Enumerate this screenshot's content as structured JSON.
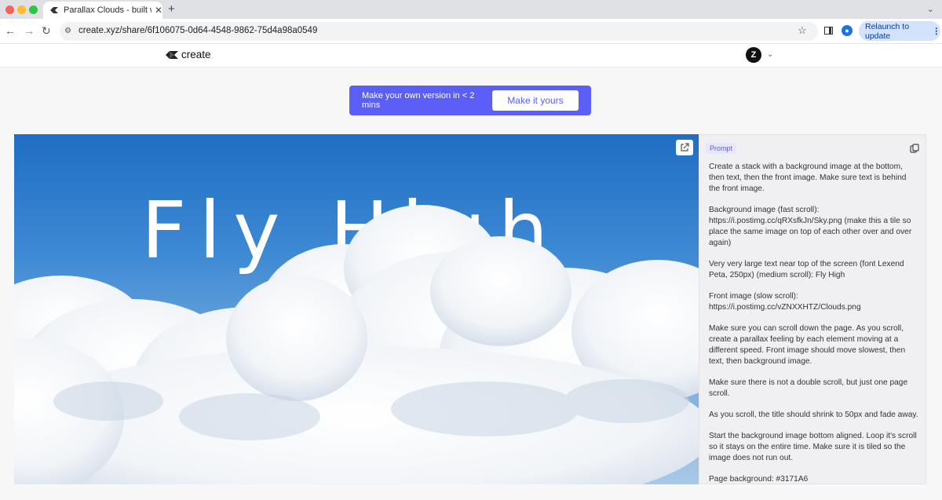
{
  "browser": {
    "tab_title": "Parallax Clouds - built with C",
    "url": "create.xyz/share/6f106075-0d64-4548-9862-75d4a98a0549",
    "relaunch_label": "Relaunch to update"
  },
  "site": {
    "logo_text": "create",
    "avatar_letter": "Z"
  },
  "cta": {
    "text": "Make your own version in < 2 mins",
    "button_label": "Make it yours"
  },
  "preview": {
    "headline": "Fly High"
  },
  "prompt": {
    "badge": "Prompt",
    "paragraphs": [
      "Create a stack with a background image at the bottom, then text, then the front image. Make sure text is behind the front image.",
      "Background image (fast scroll): https://i.postimg.cc/qRXsfkJn/Sky.png (make this a tile so place the same image on top of each other over and over again)",
      "Very very large text near top of the screen (font Lexend Peta, 250px) (medium scroll): Fly High",
      "Front image (slow scroll): https://i.postimg.cc/vZNXXHTZ/Clouds.png",
      "Make sure you can scroll down the page. As you scroll, create a parallax feeling by each element moving at a different speed. Front image should move slowest, then text, then background image.",
      "Make sure there is not a double scroll, but just one page scroll.",
      "As you scroll, the title should shrink to 50px and fade away.",
      "Start the background image bottom aligned. Loop it's scroll so it stays on the entire time. Make sure it is tiled so the image does not run out.",
      "Page background: #3171A6"
    ]
  }
}
